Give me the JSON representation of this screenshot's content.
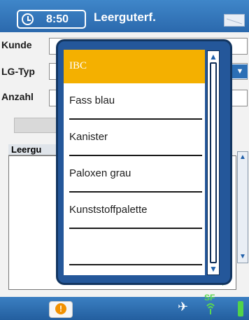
{
  "title_bar": {
    "time": "8:50",
    "title": "Leerguterf.",
    "clock_icon": "clock-icon",
    "mail_icon": "mail-icon"
  },
  "form": {
    "kunde_label": "Kunde",
    "lg_typ_label": "LG-Typ",
    "anzahl_label": "Anzahl",
    "list_header": "Leergu"
  },
  "popup": {
    "items": [
      {
        "label": "IBC",
        "selected": true
      },
      {
        "label": "Fass blau",
        "selected": false
      },
      {
        "label": "Kanister",
        "selected": false
      },
      {
        "label": "Paloxen grau",
        "selected": false
      },
      {
        "label": "Kunststoffpalette",
        "selected": false
      },
      {
        "label": "",
        "selected": false
      },
      {
        "label": "",
        "selected": false
      }
    ]
  },
  "bottom_bar": {
    "info_icon": "info-icon",
    "sf_label": "SF",
    "network_icon": "network-icon",
    "signal_icon": "signal-icon",
    "battery_icon": "battery-icon"
  },
  "colors": {
    "title_bar": "#2f73b8",
    "selected_item": "#f4b000",
    "popup_frame": "#24579a",
    "battery": "#51d34a"
  }
}
